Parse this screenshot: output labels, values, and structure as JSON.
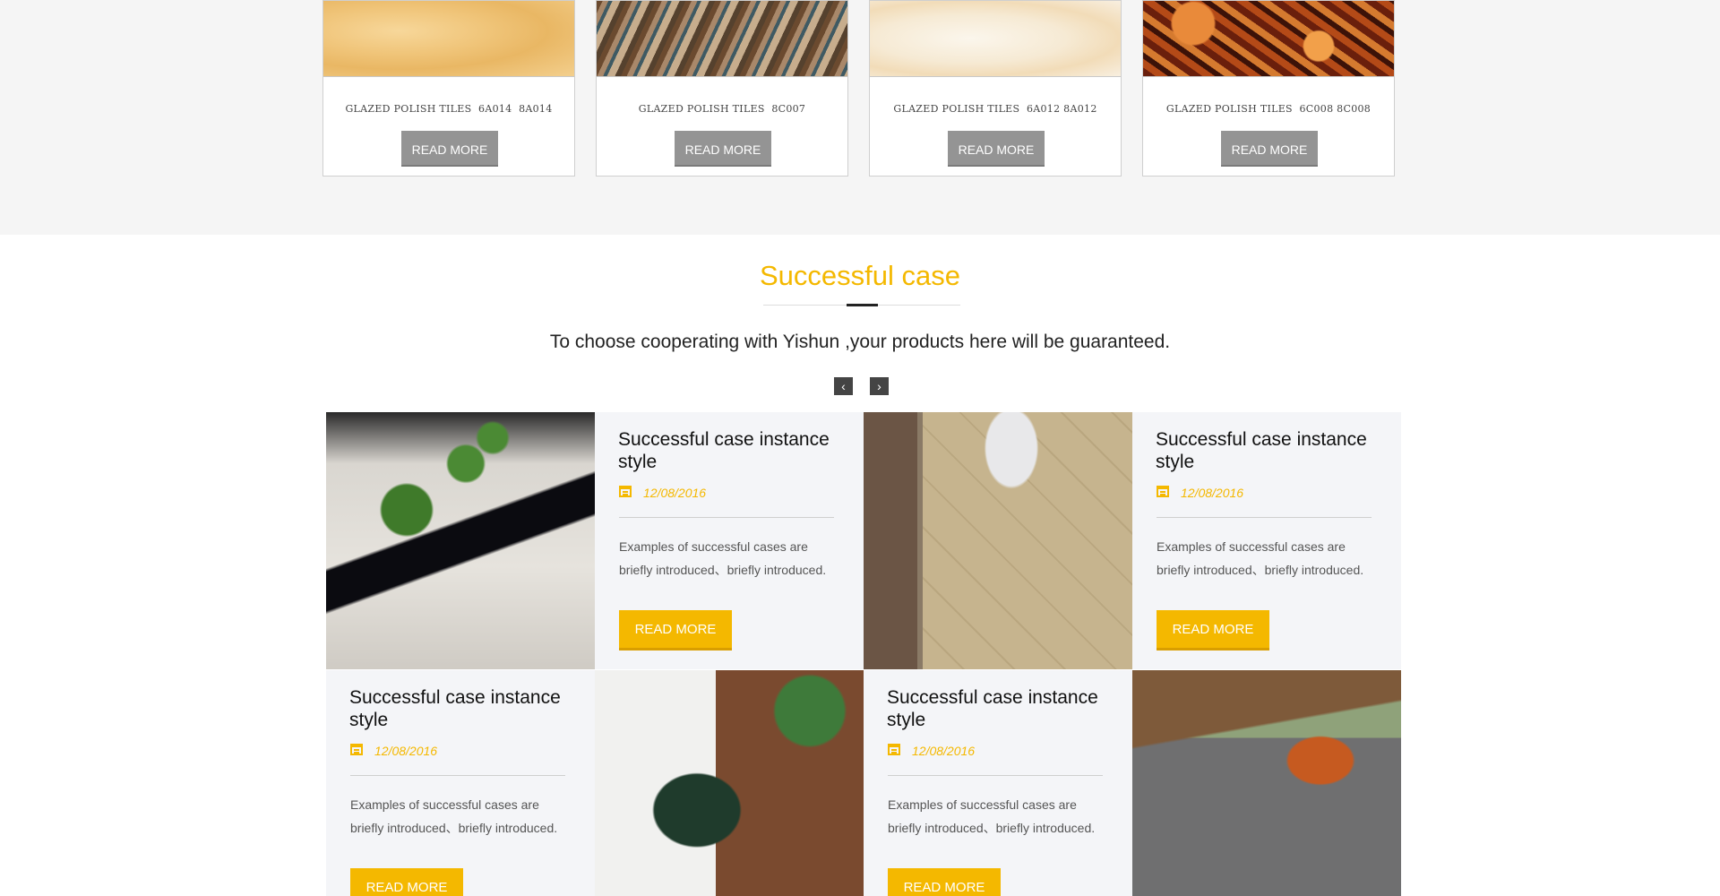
{
  "products": [
    {
      "title": "GLAZED POLISH TILES  6A014  8A014",
      "button": "READ MORE"
    },
    {
      "title": "GLAZED POLISH TILES  8C007",
      "button": "READ MORE"
    },
    {
      "title": "GLAZED POLISH TILES  6A012 8A012",
      "button": "READ MORE"
    },
    {
      "title": "GLAZED POLISH TILES  6C008 8C008",
      "button": "READ MORE"
    }
  ],
  "section": {
    "title": "Successful case",
    "subtitle": "To choose cooperating with Yishun ,your products here will be guaranteed.",
    "prev_icon": "‹",
    "next_icon": "›"
  },
  "cases": [
    {
      "title": "Successful case instance style",
      "date": "12/08/2016",
      "desc": "Examples of successful cases are briefly introduced、briefly introduced.",
      "button": "READ MORE"
    },
    {
      "title": "Successful case instance style",
      "date": "12/08/2016",
      "desc": "Examples of successful cases are briefly introduced、briefly introduced.",
      "button": "READ MORE"
    },
    {
      "title": "Successful case instance style",
      "date": "12/08/2016",
      "desc": "Examples of successful cases are briefly introduced、briefly introduced.",
      "button": "READ MORE"
    },
    {
      "title": "Successful case instance style",
      "date": "12/08/2016",
      "desc": "Examples of successful cases are briefly introduced、briefly introduced.",
      "button": "READ MORE"
    }
  ],
  "colors": {
    "accent": "#f4b800",
    "button_gray": "#949494",
    "card_bg": "#f4f5f8",
    "band_bg": "#f5f5f5"
  }
}
